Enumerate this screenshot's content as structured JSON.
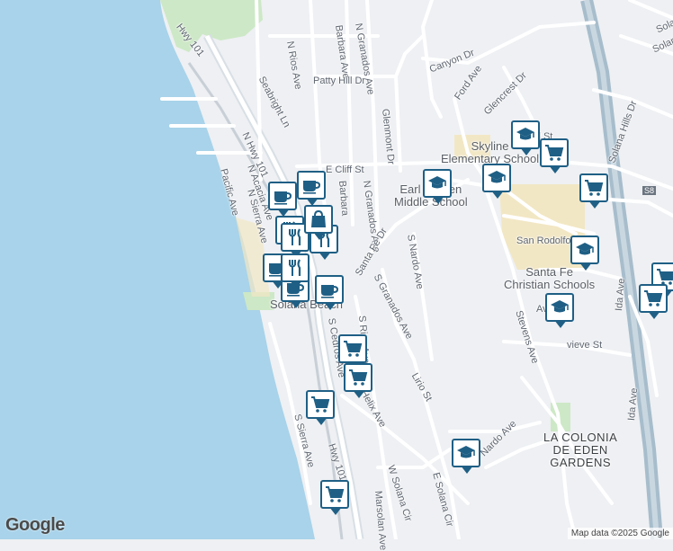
{
  "map": {
    "attribution": "Map data ©2025 Google",
    "logo": "Google",
    "colors": {
      "ocean": "#a8d3ea",
      "land": "#eef0f3",
      "road": "#ffffff",
      "highway": "#a7bdcc",
      "green": "#cde8c6",
      "school": "#f2e7c4",
      "pin": "#1f5f85"
    },
    "labels": [
      {
        "id": "hwy101-n",
        "text": "Hwy 101"
      },
      {
        "id": "hwy101-s",
        "text": "Hwy 101"
      },
      {
        "id": "n-rios",
        "text": "N Rios Ave"
      },
      {
        "id": "barbara",
        "text": "Barbara Ave"
      },
      {
        "id": "n-granados-top",
        "text": "N Granados Ave"
      },
      {
        "id": "seabright",
        "text": "Seabright Ln"
      },
      {
        "id": "patty-hill",
        "text": "Patty Hill Dr"
      },
      {
        "id": "canyon",
        "text": "Canyon Dr"
      },
      {
        "id": "ford",
        "text": "Ford Ave"
      },
      {
        "id": "glencrest",
        "text": "Glencrest Dr"
      },
      {
        "id": "glenmont",
        "text": "Glenmont Dr"
      },
      {
        "id": "n-hwy101",
        "text": "N Hwy 101"
      },
      {
        "id": "n-acacia",
        "text": "N Acacia Ave"
      },
      {
        "id": "pacific",
        "text": "Pacific Ave"
      },
      {
        "id": "n-sierra",
        "text": "N Sierra Ave"
      },
      {
        "id": "cliff",
        "text": "E Cliff St"
      },
      {
        "id": "barbara2",
        "text": "Barbara"
      },
      {
        "id": "n-granados2",
        "text": "N Granados Ave"
      },
      {
        "id": "santa-fe",
        "text": "Santa Fe Dr"
      },
      {
        "id": "s-granados",
        "text": "S Granados Ave"
      },
      {
        "id": "s-nardo",
        "text": "S Nardo Ave"
      },
      {
        "id": "lirio",
        "text": "Lirio St"
      },
      {
        "id": "s-rios",
        "text": "S Rios Ave"
      },
      {
        "id": "s-cedros",
        "text": "S Cedros Ave"
      },
      {
        "id": "s-helix",
        "text": "S Helix Ave"
      },
      {
        "id": "s-sierra",
        "text": "S Sierra Ave"
      },
      {
        "id": "w-solana-cir",
        "text": "W Solana Cir"
      },
      {
        "id": "e-solana-cir",
        "text": "E Solana Cir"
      },
      {
        "id": "marsolan",
        "text": "Marsolan Ave"
      },
      {
        "id": "nardo-ave",
        "text": "Nardo Ave"
      },
      {
        "id": "stevens",
        "text": "Stevens Ave"
      },
      {
        "id": "san-rodolfo",
        "text": "San Rodolfo Dr"
      },
      {
        "id": "solana-hills",
        "text": "Solana Hills Dr"
      },
      {
        "id": "ida-ave",
        "text": "Ida Ave"
      },
      {
        "id": "ida-ave-2",
        "text": "Ida Ave"
      },
      {
        "id": "avenida",
        "text": "Av  Dr"
      },
      {
        "id": "genevieve",
        "text": "vieve St"
      },
      {
        "id": "s-label",
        "text": "S8"
      },
      {
        "id": "hill-st",
        "text": "ll St"
      },
      {
        "id": "solana-top",
        "text": "Sola"
      },
      {
        "id": "solana-top2",
        "text": "Solana"
      }
    ],
    "places": [
      {
        "id": "skyline",
        "lines": [
          "Skyline",
          "Elementary School"
        ]
      },
      {
        "id": "earl-warren",
        "lines": [
          "Earl Warren",
          "Middle School"
        ]
      },
      {
        "id": "santa-fe-christian",
        "lines": [
          "Santa Fe",
          "Christian Schools"
        ]
      },
      {
        "id": "solana-beach",
        "lines": [
          "Solana Beach"
        ]
      },
      {
        "id": "la-colonia",
        "lines": [
          "LA COLONIA",
          "DE EDEN",
          "GARDENS"
        ]
      }
    ],
    "pins": [
      {
        "type": "school"
      },
      {
        "type": "school"
      },
      {
        "type": "school"
      },
      {
        "type": "school"
      },
      {
        "type": "school"
      },
      {
        "type": "school"
      },
      {
        "type": "grocery"
      },
      {
        "type": "grocery"
      },
      {
        "type": "grocery"
      },
      {
        "type": "grocery"
      },
      {
        "type": "grocery"
      },
      {
        "type": "grocery"
      },
      {
        "type": "grocery"
      },
      {
        "type": "grocery"
      },
      {
        "type": "cafe"
      },
      {
        "type": "cafe"
      },
      {
        "type": "cafe"
      },
      {
        "type": "cafe"
      },
      {
        "type": "cafe"
      },
      {
        "type": "restaurant"
      },
      {
        "type": "restaurant"
      },
      {
        "type": "restaurant"
      },
      {
        "type": "restaurant"
      },
      {
        "type": "shopping"
      }
    ]
  }
}
